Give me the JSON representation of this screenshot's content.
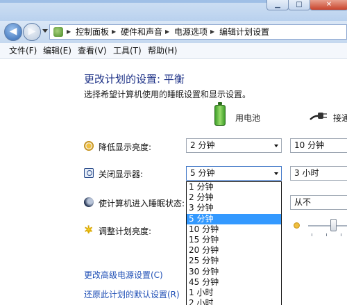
{
  "address_bar": {
    "crumbs": [
      "控制面板",
      "硬件和声音",
      "电源选项",
      "编辑计划设置"
    ]
  },
  "menu": [
    "文件(F)",
    "编辑(E)",
    "查看(V)",
    "工具(T)",
    "帮助(H)"
  ],
  "page": {
    "title": "更改计划的设置: 平衡",
    "subtitle": "选择希望计算机使用的睡眠设置和显示设置。",
    "col_battery": "用电池",
    "col_plugged": "接通"
  },
  "rows": [
    {
      "label": "降低显示亮度:",
      "battery": "2 分钟",
      "plugged": "10 分钟",
      "icon": "dim-display-icon"
    },
    {
      "label": "关闭显示器:",
      "battery": "5 分钟",
      "plugged": "3 小时",
      "icon": "display-off-icon"
    },
    {
      "label": "使计算机进入睡眠状态:",
      "plugged": "从不",
      "icon": "sleep-moon-icon"
    },
    {
      "label": "调整计划亮度:",
      "icon": "brightness-sun-icon",
      "plugged_brightness_level": 0.6
    }
  ],
  "dropdown_options": [
    "1 分钟",
    "2 分钟",
    "3 分钟",
    "5 分钟",
    "10 分钟",
    "15 分钟",
    "20 分钟",
    "25 分钟",
    "30 分钟",
    "45 分钟",
    "1 小时",
    "2 小时"
  ],
  "dropdown_selected": "5 分钟",
  "links": {
    "advanced": "更改高级电源设置(C)",
    "restore": "还原此计划的默认设置(R)"
  },
  "colors": {
    "title_blue": "#1e3287",
    "link_blue": "#1f4fb6",
    "selection": "#3399ff"
  }
}
